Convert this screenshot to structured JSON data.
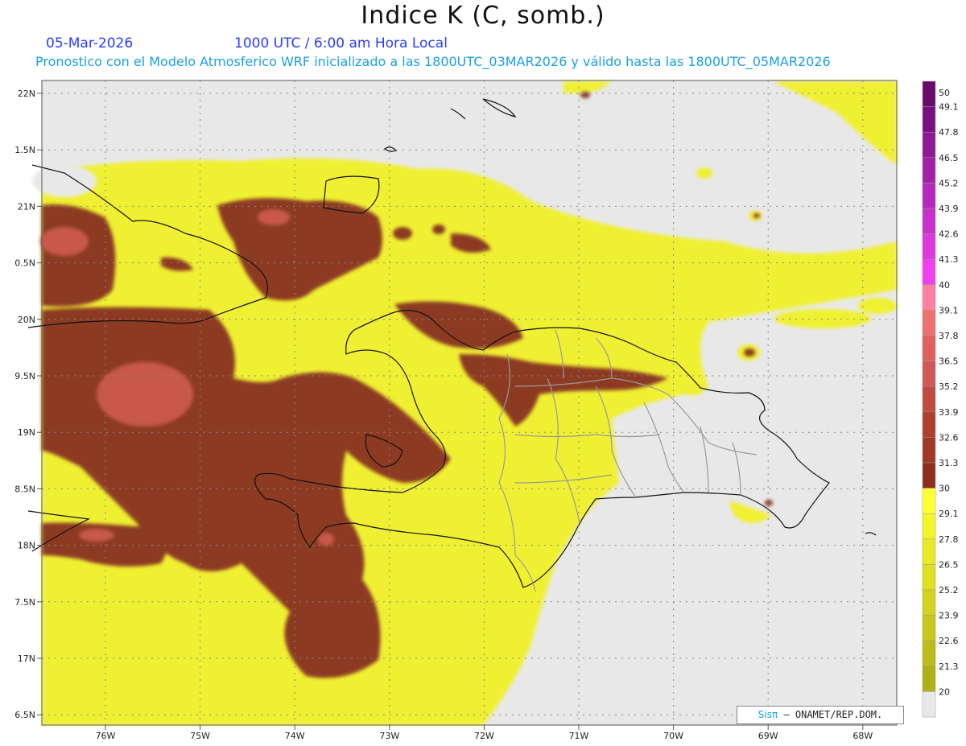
{
  "title": "Indice K (C, somb.)",
  "date": "05-Mar-2026",
  "time": "1000 UTC / 6:00 am Hora Local",
  "subtitle": "Pronostico con el Modelo Atmosferico WRF inicializado a las 1800UTC_03MAR2026 y válido hasta las  1800UTC_05MAR2026",
  "credit": {
    "logo": "Sisπ",
    "text": "– ONAMET/REP.DOM."
  },
  "lat_labels": [
    "22N",
    "1.5N",
    "21N",
    "0.5N",
    "20N",
    "9.5N",
    "19N",
    "8.5N",
    "18N",
    "7.5N",
    "17N",
    "6.5N"
  ],
  "lon_labels": [
    "76W",
    "75W",
    "74W",
    "73W",
    "72W",
    "71W",
    "70W",
    "69W",
    "68W"
  ],
  "colorbar": {
    "labels": [
      "50",
      "49.1",
      "47.8",
      "46.5",
      "45.2",
      "43.9",
      "42.6",
      "41.3",
      "40",
      "39.1",
      "37.8",
      "36.5",
      "35.2",
      "33.9",
      "32.6",
      "31.3",
      "30",
      "29.1",
      "27.8",
      "26.5",
      "25.2",
      "23.9",
      "22.6",
      "21.3",
      "20"
    ],
    "colors": [
      "#6a0a6a",
      "#7a0f7f",
      "#8e1a94",
      "#a020a8",
      "#b428bb",
      "#c830cc",
      "#dc38dc",
      "#ee40ee",
      "#ff80a0",
      "#f07070",
      "#e06060",
      "#d05858",
      "#c04a42",
      "#b0402e",
      "#a03826",
      "#8e2e1e",
      "#ffff33",
      "#f4f428",
      "#eaea24",
      "#e0e020",
      "#d4d41e",
      "#c8c81c",
      "#bcbc1a",
      "#b0b018",
      "#e8e8e8"
    ]
  }
}
